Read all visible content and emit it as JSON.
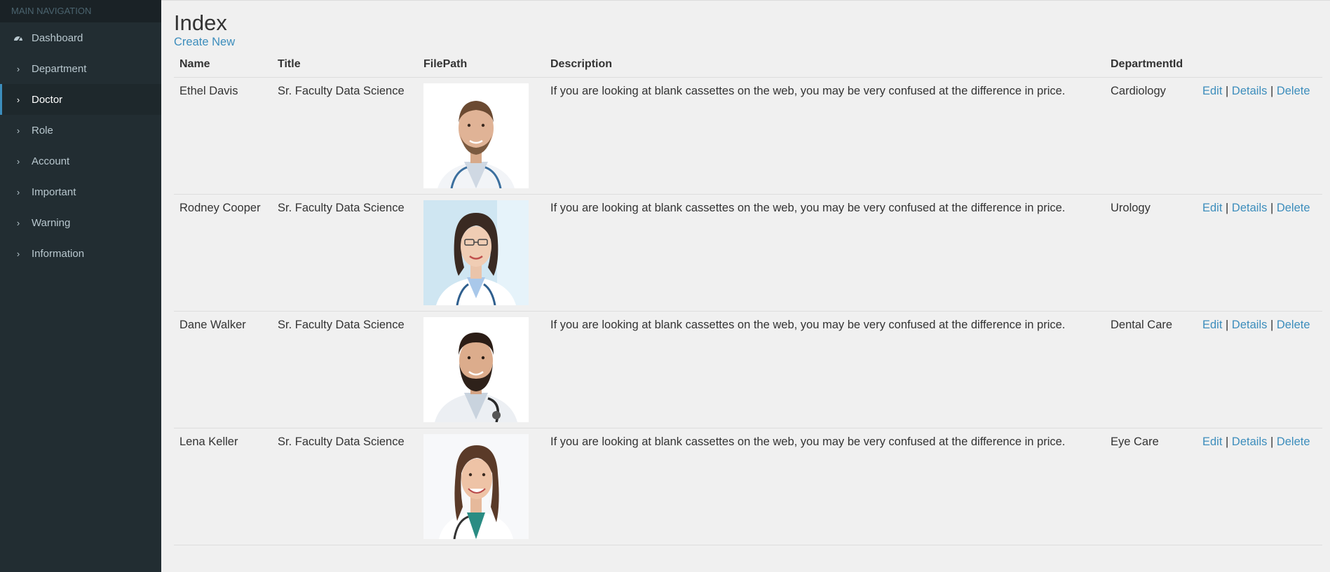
{
  "sidebar": {
    "header": "MAIN NAVIGATION",
    "items": [
      {
        "label": "Dashboard",
        "icon": "dashboard-icon"
      },
      {
        "label": "Department",
        "icon": "chevron-right-icon"
      },
      {
        "label": "Doctor",
        "icon": "chevron-right-icon",
        "active": true
      },
      {
        "label": "Role",
        "icon": "chevron-right-icon"
      },
      {
        "label": "Account",
        "icon": "chevron-right-icon"
      },
      {
        "label": "Important",
        "icon": "chevron-right-icon"
      },
      {
        "label": "Warning",
        "icon": "chevron-right-icon"
      },
      {
        "label": "Information",
        "icon": "chevron-right-icon"
      }
    ]
  },
  "main": {
    "title": "Index",
    "create_label": "Create New",
    "columns": [
      "Name",
      "Title",
      "FilePath",
      "Description",
      "DepartmentId"
    ],
    "actions": {
      "edit": "Edit",
      "details": "Details",
      "delete": "Delete",
      "separator": "|"
    },
    "rows": [
      {
        "name": "Ethel Davis",
        "title": "Sr. Faculty Data Science",
        "photo": "doctor-photo-male-1",
        "description": "If you are looking at blank cassettes on the web, you may be very confused at the difference in price.",
        "department": "Cardiology"
      },
      {
        "name": "Rodney Cooper",
        "title": "Sr. Faculty Data Science",
        "photo": "doctor-photo-female-1",
        "description": "If you are looking at blank cassettes on the web, you may be very confused at the difference in price.",
        "department": "Urology"
      },
      {
        "name": "Dane Walker",
        "title": "Sr. Faculty Data Science",
        "photo": "doctor-photo-male-2",
        "description": "If you are looking at blank cassettes on the web, you may be very confused at the difference in price.",
        "department": "Dental Care"
      },
      {
        "name": "Lena Keller",
        "title": "Sr. Faculty Data Science",
        "photo": "doctor-photo-female-2",
        "description": "If you are looking at blank cassettes on the web, you may be very confused at the difference in price.",
        "department": "Eye Care"
      }
    ]
  },
  "colors": {
    "sidebar_bg": "#222d32",
    "sidebar_header_bg": "#1a2226",
    "active_accent": "#3c8dbc",
    "link": "#3c8dbc",
    "page_bg": "#f0f0f0"
  }
}
